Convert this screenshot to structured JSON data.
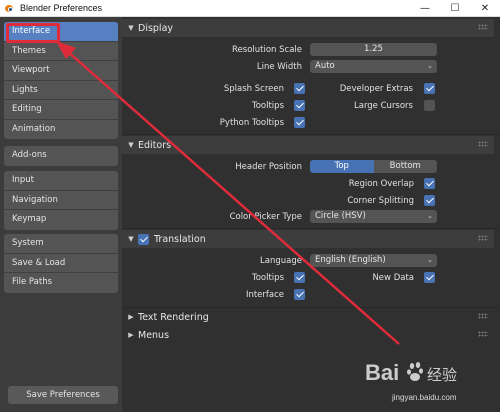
{
  "window": {
    "title": "Blender Preferences",
    "minimize": "—",
    "maximize": "☐",
    "close": "✕"
  },
  "sidebar": {
    "groups": [
      [
        "Interface",
        "Themes",
        "Viewport",
        "Lights",
        "Editing",
        "Animation"
      ],
      [
        "Add-ons"
      ],
      [
        "Input",
        "Navigation",
        "Keymap"
      ],
      [
        "System",
        "Save & Load",
        "File Paths"
      ]
    ],
    "active": "Interface",
    "save_button": "Save Preferences"
  },
  "display": {
    "title": "Display",
    "resolution_scale_label": "Resolution Scale",
    "resolution_scale_value": "1.25",
    "line_width_label": "Line Width",
    "line_width_value": "Auto",
    "splash_screen_label": "Splash Screen",
    "splash_screen": true,
    "developer_extras_label": "Developer Extras",
    "developer_extras": true,
    "tooltips_label": "Tooltips",
    "tooltips": true,
    "large_cursors_label": "Large Cursors",
    "large_cursors": false,
    "python_tooltips_label": "Python Tooltips",
    "python_tooltips": true
  },
  "editors": {
    "title": "Editors",
    "header_position_label": "Header Position",
    "header_position_options": [
      "Top",
      "Bottom"
    ],
    "header_position_selected": "Top",
    "region_overlap_label": "Region Overlap",
    "region_overlap": true,
    "corner_splitting_label": "Corner Splitting",
    "corner_splitting": true,
    "color_picker_label": "Color Picker Type",
    "color_picker_value": "Circle (HSV)"
  },
  "translation": {
    "title": "Translation",
    "enabled": true,
    "language_label": "Language",
    "language_value": "English (English)",
    "tooltips_label": "Tooltips",
    "tooltips": true,
    "new_data_label": "New Data",
    "new_data": true,
    "interface_label": "Interface",
    "interface": true
  },
  "collapsed_panels": [
    "Text Rendering",
    "Menus"
  ],
  "watermark": {
    "logo_text": "Bai 经验",
    "url": "jingyan.baidu.com"
  },
  "colors": {
    "accent": "#4772b3",
    "active_tab": "#5680c2",
    "annotation": "#e02b3a"
  }
}
